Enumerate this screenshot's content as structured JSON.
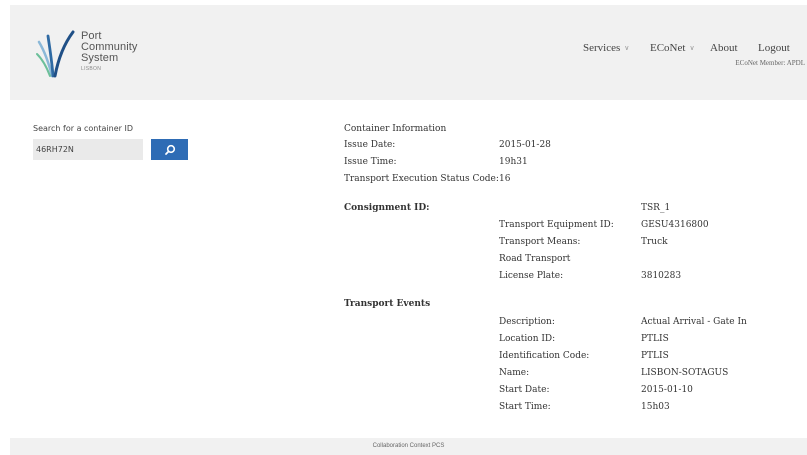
{
  "logo": {
    "line1": "Port",
    "line2": "Community",
    "line3": "System",
    "sub": "LISBON"
  },
  "nav": {
    "services": "Services",
    "econet": "ECoNet",
    "about": "About",
    "logout": "Logout"
  },
  "member_label": "ECoNet Member: APDL",
  "search": {
    "label": "Search for a container ID",
    "value": "46RH72N"
  },
  "container": {
    "heading": "Container Information",
    "issue_date_label": "Issue Date:",
    "issue_date": "2015-01-28",
    "issue_time_label": "Issue Time:",
    "issue_time": "19h31",
    "status_code_label": "Transport Execution Status Code:",
    "status_code": "16"
  },
  "consignment": {
    "heading": "Consignment ID:",
    "id": "TSR_1",
    "equipment_label": "Transport Equipment ID:",
    "equipment": "GESU4316800",
    "means_label": "Transport Means:",
    "means": "Truck",
    "mode": "Road Transport",
    "plate_label": "License Plate:",
    "plate": "3810283"
  },
  "events": {
    "heading": "Transport Events",
    "description_label": "Description:",
    "description": "Actual Arrival - Gate In",
    "location_label": "Location ID:",
    "location": "PTLIS",
    "ident_label": "Identification Code:",
    "ident": "PTLIS",
    "name_label": "Name:",
    "name": "LISBON-SOTAGUS",
    "start_date_label": "Start Date:",
    "start_date": "2015-01-10",
    "start_time_label": "Start Time:",
    "start_time": "15h03"
  },
  "footer": "Collaboration Context PCS",
  "colors": {
    "accent": "#2e6cb5",
    "panel": "#f1f1f1"
  }
}
